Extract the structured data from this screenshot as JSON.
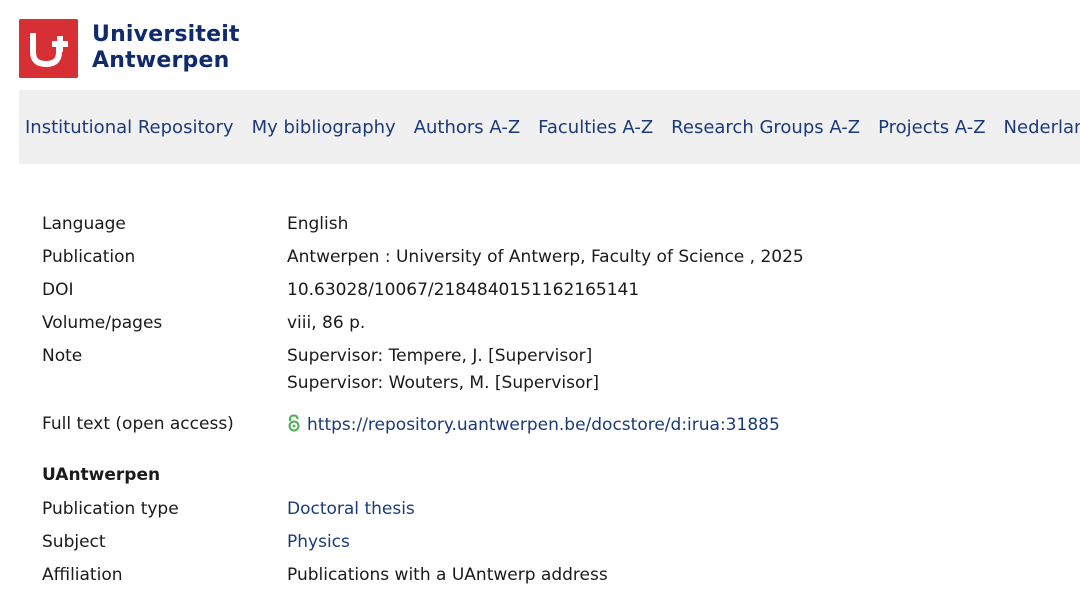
{
  "branding": {
    "name_line1": "Universiteit",
    "name_line2": "Antwerpen"
  },
  "nav": {
    "items": [
      {
        "label": "Institutional Repository"
      },
      {
        "label": "My bibliography"
      },
      {
        "label": "Authors A-Z"
      },
      {
        "label": "Faculties A-Z"
      },
      {
        "label": "Research Groups A-Z"
      },
      {
        "label": "Projects A-Z"
      },
      {
        "label": "Nederlands"
      }
    ]
  },
  "record": {
    "language": {
      "label": "Language",
      "value": "English"
    },
    "publication": {
      "label": "Publication",
      "value": "Antwerpen : University of Antwerp, Faculty of Science , 2025"
    },
    "doi": {
      "label": "DOI",
      "value": "10.63028/10067/2184840151162165141"
    },
    "volume": {
      "label": "Volume/pages",
      "value": "viii, 86 p."
    },
    "note": {
      "label": "Note",
      "lines": [
        "Supervisor: Tempere, J. [Supervisor]",
        "Supervisor: Wouters, M. [Supervisor]"
      ]
    },
    "fulltext": {
      "label": "Full text (open access)",
      "url": "https://repository.uantwerpen.be/docstore/d:irua:31885",
      "icon": "open-access-lock-icon"
    }
  },
  "uantwerpen": {
    "heading": "UAntwerpen",
    "publication_type": {
      "label": "Publication type",
      "value": "Doctoral thesis"
    },
    "subject": {
      "label": "Subject",
      "value": "Physics"
    },
    "affiliation": {
      "label": "Affiliation",
      "value": "Publications with a UAntwerp address"
    }
  },
  "colors": {
    "brand_red": "#d62f34",
    "brand_navy": "#0f2b6b",
    "link_blue": "#1b3a7a",
    "open_access_green": "#4caf50",
    "nav_bg": "#f0f0f0"
  }
}
